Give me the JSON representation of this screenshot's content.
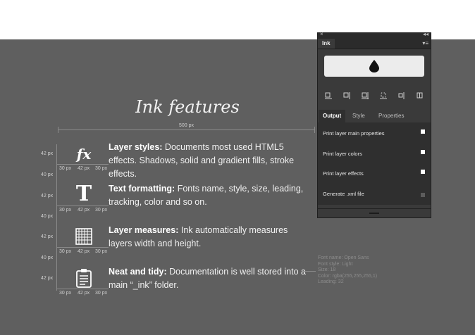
{
  "page": {
    "title": "Ink features",
    "width_label": "500 px",
    "colors": {
      "canvas": "#5f5f5f",
      "panel": "#3a3a3a",
      "accent_white": "#ffffff"
    }
  },
  "features": [
    {
      "icon": "fx-icon",
      "heading": "Layer styles:",
      "text": " Documents most used HTML5 effects. Shadows, solid and gradient fills, stroke effects."
    },
    {
      "icon": "text-t-icon",
      "heading": "Text formatting:",
      "text": " Fonts name, style, size, leading, tracking, color and so on."
    },
    {
      "icon": "grid-measure-icon",
      "heading": "Layer measures:",
      "text": " Ink automatically measures layers width and height."
    },
    {
      "icon": "clipboard-icon",
      "heading": "Neat and tidy:",
      "text": "  Documentation is well stored into a main “_ink” folder."
    }
  ],
  "dims": {
    "h42": "42 px",
    "h40": "40 px",
    "w30": "30 px",
    "w42": "42 px"
  },
  "measure_note": [
    "Font name: Open Sans",
    "Font style: Light",
    "Size: 18",
    "Color: rgba(255,255,255,1)",
    "Leading: 32"
  ],
  "panel": {
    "close": "×",
    "collapse": "◂◂",
    "tab": "Ink",
    "menu": "▾≡",
    "output_tabs": [
      "Output",
      "Style",
      "Properties"
    ],
    "options": [
      {
        "label": "Print layer main properties",
        "checked": true
      },
      {
        "label": "Print layer colors",
        "checked": true
      },
      {
        "label": "Print layer effects",
        "checked": true
      },
      {
        "label": "Generate .xml file",
        "checked": false
      }
    ]
  }
}
